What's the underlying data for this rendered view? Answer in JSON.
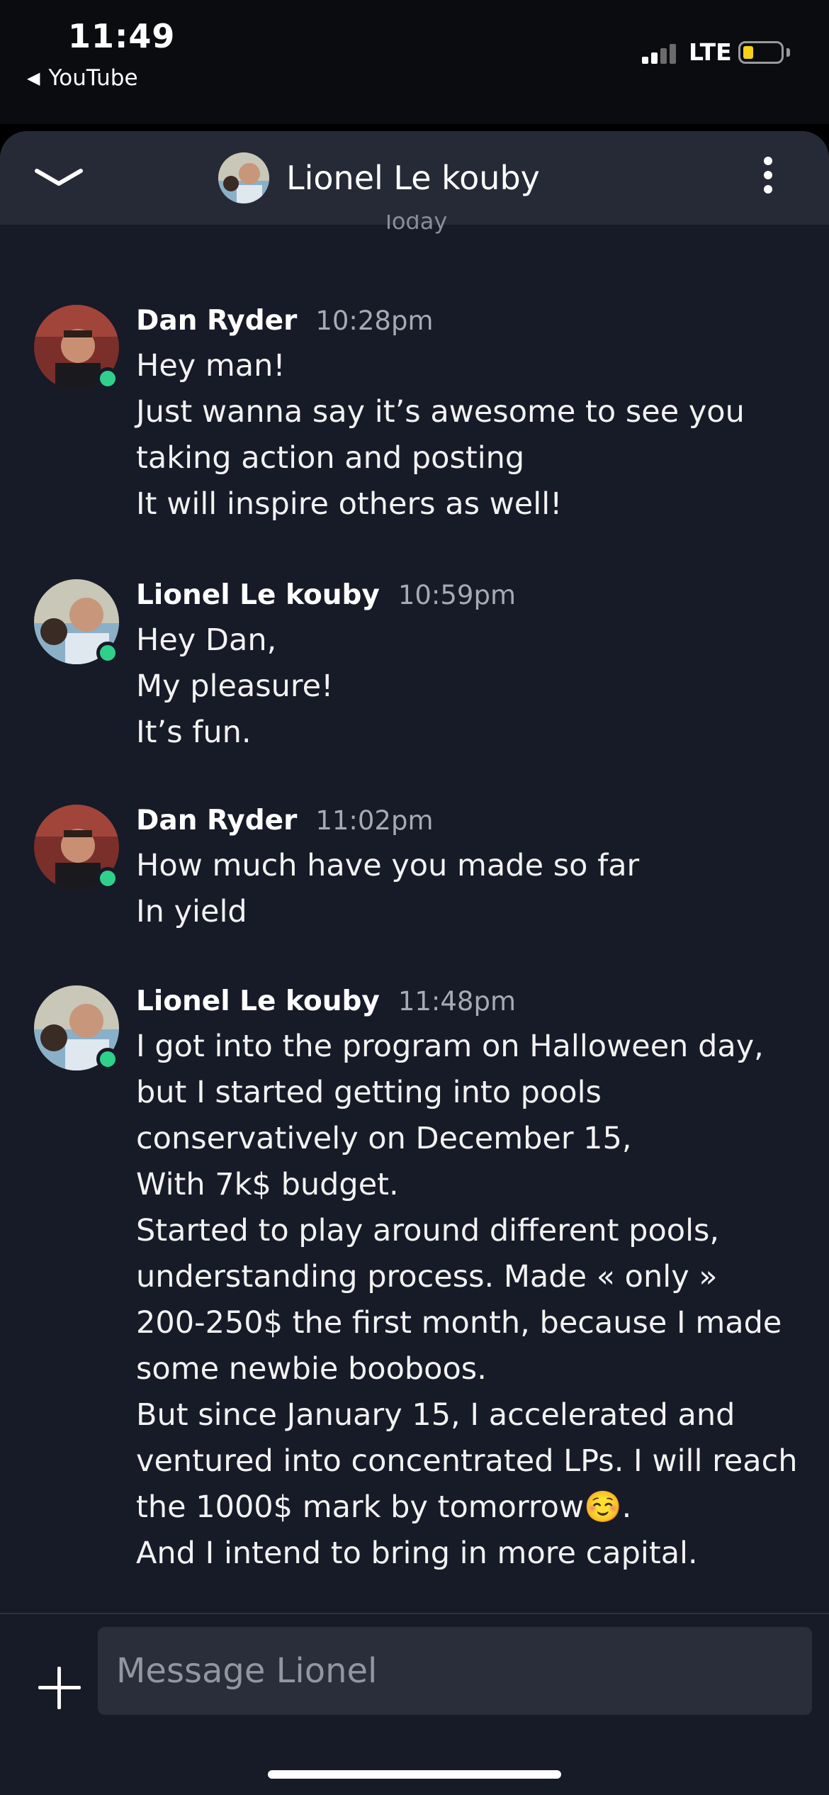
{
  "status_bar": {
    "time": "11:49",
    "back_app": "YouTube",
    "network": "LTE",
    "back_glyph": "◀"
  },
  "header": {
    "contact_name": "Lionel Le kouby",
    "collapse_icon": "chevron-down-icon",
    "menu_icon": "more-vertical-icon"
  },
  "day_label": "Today",
  "messages": [
    {
      "author": "Dan Ryder",
      "time": "10:28pm",
      "lines": [
        "Hey man!",
        "Just wanna say it’s awesome to see you",
        "taking action and posting",
        "It will inspire others as well!"
      ]
    },
    {
      "author": "Lionel Le kouby",
      "time": "10:59pm",
      "lines": [
        "Hey Dan,",
        "My pleasure!",
        "It’s fun."
      ]
    },
    {
      "author": "Dan Ryder",
      "time": "11:02pm",
      "lines": [
        "How much have you made so far",
        "In yield"
      ]
    },
    {
      "author": "Lionel Le kouby",
      "time": "11:48pm",
      "lines": [
        "I got into the program on Halloween day,",
        "but I started getting into pools",
        "conservatively on December 15,",
        "With 7k$ budget.",
        "Started to play around different pools,",
        "understanding process. Made « only »",
        "200-250$ the first month, because I made",
        "some newbie booboos.",
        "But since January 15, I accelerated and",
        "ventured into concentrated LPs. I will reach",
        "the 1000$ mark by tomorrow☺️.",
        "And I intend to bring in more capital."
      ]
    }
  ],
  "composer": {
    "placeholder": "Message Lionel",
    "value": ""
  },
  "colors": {
    "background": "#171a27",
    "header": "#262a36",
    "online": "#2fd08b",
    "input": "#2a2e3a"
  }
}
